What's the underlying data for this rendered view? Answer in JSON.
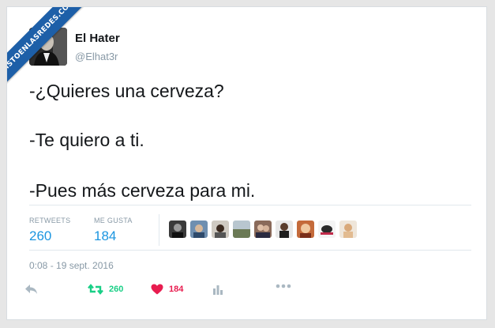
{
  "watermark": {
    "text": "VISTOENLASREDES.COM"
  },
  "tweet": {
    "author": {
      "name": "El Hater",
      "handle": "@Elhat3r"
    },
    "lines": [
      "-¿Quieres una cerveza?",
      "-Te quiero a ti.",
      "-Pues más cerveza para mi."
    ],
    "stats": {
      "retweets_label": "RETWEETS",
      "retweets": "260",
      "likes_label": "ME GUSTA",
      "likes": "184"
    },
    "likers_count": 9,
    "timestamp": "0:08 - 19 sept. 2016",
    "actions": {
      "reply_icon": "reply-icon",
      "retweet_icon": "retweet-icon",
      "retweet_count": "260",
      "like_icon": "heart-icon",
      "like_count": "184",
      "analytics_icon": "analytics-icon",
      "more_icon": "more-icon"
    }
  },
  "colors": {
    "link": "#1b95e0",
    "retweet": "#19cf86",
    "like": "#e81c4f",
    "muted": "#aab8c2",
    "ribbon": "#1d5fa8"
  }
}
